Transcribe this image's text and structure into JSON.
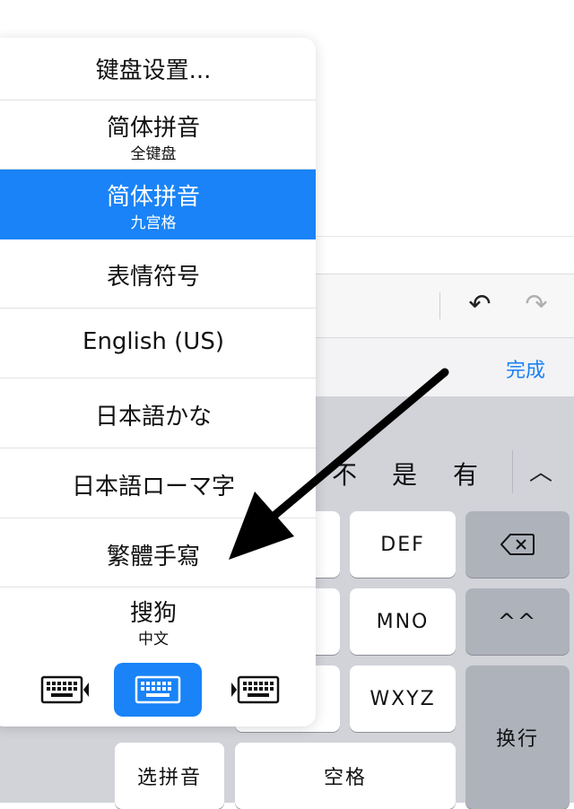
{
  "toolbar": {
    "undo_icon": "undo-icon",
    "redo_icon": "redo-icon"
  },
  "accessory": {
    "done_label": "完成"
  },
  "candidates": [
    "不",
    "是",
    "有"
  ],
  "keyboard": {
    "keys": {
      "def": "DEF",
      "mno": "MNO",
      "wxyz": "WXYZ",
      "emoticon": "^^",
      "return": "换行",
      "select_pinyin": "选拼音",
      "space": "空格"
    }
  },
  "menu": {
    "items": [
      {
        "main": "键盘设置...",
        "sub": ""
      },
      {
        "main": "简体拼音",
        "sub": "全键盘"
      },
      {
        "main": "简体拼音",
        "sub": "九宫格",
        "selected": true
      },
      {
        "main": "表情符号",
        "sub": ""
      },
      {
        "main": "English (US)",
        "sub": ""
      },
      {
        "main": "日本語かな",
        "sub": ""
      },
      {
        "main": "日本語ローマ字",
        "sub": ""
      },
      {
        "main": "繁體手寫",
        "sub": ""
      },
      {
        "main": "搜狗",
        "sub": "中文"
      }
    ]
  },
  "colors": {
    "accent": "#1983f7",
    "keyboard_bg": "#d1d3d9"
  }
}
